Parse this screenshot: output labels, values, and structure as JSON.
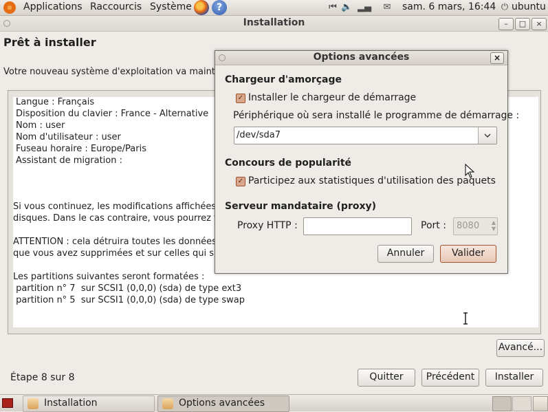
{
  "top_panel": {
    "menus": [
      "Applications",
      "Raccourcis",
      "Système"
    ],
    "clock": "sam.  6 mars, 16:44",
    "user": "ubuntu"
  },
  "window": {
    "title": "Installation",
    "minimize": "–",
    "maximize": "□",
    "close": "×"
  },
  "page": {
    "heading": "Prêt à installer",
    "intro": "Votre nouveau système d'exploitation va maint",
    "summary_lines": [
      "Langue : Français",
      "Disposition du clavier : France - Alternative",
      "Nom : user",
      "Nom d'utilisateur : user",
      "Fuseau horaire : Europe/Paris",
      "Assistant de migration :",
      "Si vous continuez, les modifications affichées",
      "disques. Dans le cas contraire, vous pourrez f",
      "ATTENTION : cela détruira toutes les données",
      "que vous avez supprimées et sur celles qui s",
      "Les partitions suivantes seront formatées :",
      " partition n° 7  sur SCSI1 (0,0,0) (sda) de type ext3",
      " partition n° 5  sur SCSI1 (0,0,0) (sda) de type swap"
    ],
    "advanced_button": "Avancé...",
    "step": "Étape 8 sur 8",
    "quit_button": "Quitter",
    "back_button": "Précédent",
    "install_button": "Installer"
  },
  "dialog": {
    "title": "Options avancées",
    "bootloader_section": "Chargeur d'amorçage",
    "install_bootloader_label": "Installer le chargeur de démarrage",
    "install_bootloader_checked": true,
    "device_label": "Périphérique où sera installé le programme de démarrage :",
    "device_value": "/dev/sda7",
    "popularity_section": "Concours de popularité",
    "popularity_label": "Participez aux statistiques d'utilisation des paquets",
    "popularity_checked": true,
    "proxy_section": "Serveur mandataire (proxy)",
    "proxy_http_label": "Proxy HTTP :",
    "proxy_http_value": "",
    "port_label": "Port :",
    "port_value": "8080",
    "cancel_button": "Annuler",
    "ok_button": "Valider"
  },
  "taskbar": {
    "tasks": [
      "Installation",
      "Options avancées"
    ]
  },
  "icons": {
    "distributor_logo": "ubuntu-logo-icon",
    "browser": "firefox-icon",
    "help": "help-icon",
    "volume": "volume-icon",
    "network": "network-icon",
    "mail": "mail-icon",
    "power": "power-icon"
  }
}
